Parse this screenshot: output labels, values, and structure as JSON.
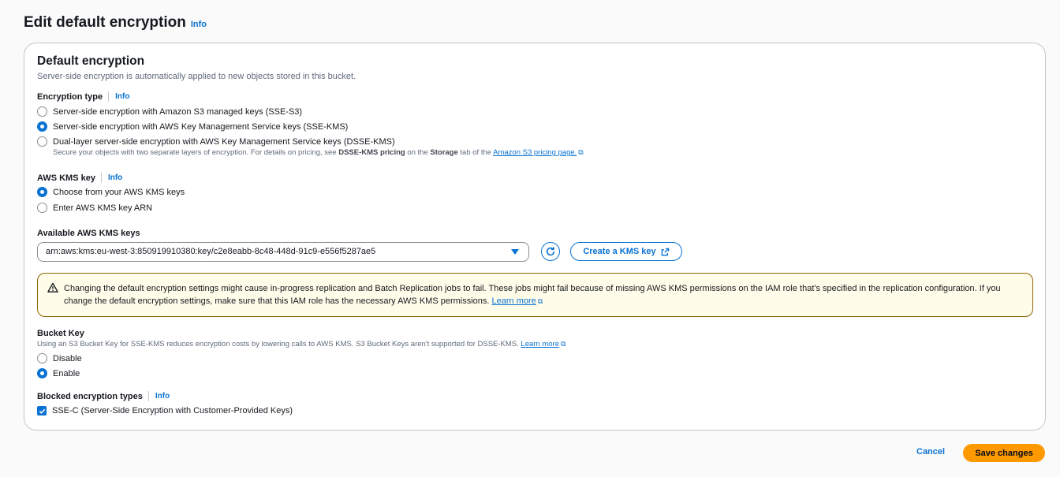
{
  "header": {
    "title": "Edit default encryption",
    "info": "Info"
  },
  "panel": {
    "title": "Default encryption",
    "description": "Server-side encryption is automatically applied to new objects stored in this bucket.",
    "encryption_type": {
      "label": "Encryption type",
      "info": "Info",
      "options": [
        {
          "label": "Server-side encryption with Amazon S3 managed keys (SSE-S3)",
          "checked": false
        },
        {
          "label": "Server-side encryption with AWS Key Management Service keys (SSE-KMS)",
          "checked": true
        },
        {
          "label": "Dual-layer server-side encryption with AWS Key Management Service keys (DSSE-KMS)",
          "checked": false
        }
      ],
      "dsse_hint_pre": "Secure your objects with two separate layers of encryption. For details on pricing, see ",
      "dsse_hint_bold1": "DSSE-KMS pricing",
      "dsse_hint_mid": " on the ",
      "dsse_hint_bold2": "Storage",
      "dsse_hint_post": " tab of the ",
      "dsse_hint_link": "Amazon S3 pricing page."
    },
    "kms_key": {
      "label": "AWS KMS key",
      "info": "Info",
      "options": [
        {
          "label": "Choose from your AWS KMS keys",
          "checked": true
        },
        {
          "label": "Enter AWS KMS key ARN",
          "checked": false
        }
      ]
    },
    "available_keys": {
      "label": "Available AWS KMS keys",
      "selected": "arn:aws:kms:eu-west-3:850919910380:key/c2e8eabb-8c48-448d-91c9-e556f5287ae5",
      "create_button": "Create a KMS key"
    },
    "alert": {
      "text": "Changing the default encryption settings might cause in-progress replication and Batch Replication jobs to fail. These jobs might fail because of missing AWS KMS permissions on the IAM role that's specified in the replication configuration. If you change the default encryption settings, make sure that this IAM role has the necessary AWS KMS permissions. ",
      "link": "Learn more"
    },
    "bucket_key": {
      "label": "Bucket Key",
      "description": "Using an S3 Bucket Key for SSE-KMS reduces encryption costs by lowering calls to AWS KMS. S3 Bucket Keys aren't supported for DSSE-KMS. ",
      "link": "Learn more",
      "options": [
        {
          "label": "Disable",
          "checked": false
        },
        {
          "label": "Enable",
          "checked": true
        }
      ]
    },
    "blocked_types": {
      "label": "Blocked encryption types",
      "info": "Info",
      "checkbox_label": "SSE-C (Server-Side Encryption with Customer-Provided Keys)",
      "checked": true
    }
  },
  "footer": {
    "cancel": "Cancel",
    "save": "Save changes"
  },
  "colors": {
    "accent": "#0972d3",
    "primary_button": "#ff9900",
    "warning_bg": "#fffce9"
  }
}
